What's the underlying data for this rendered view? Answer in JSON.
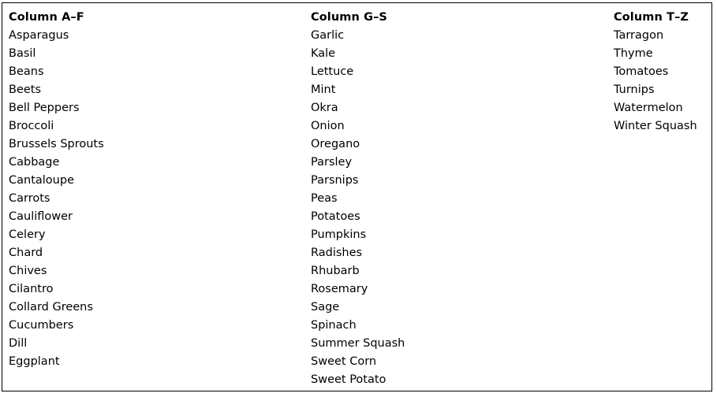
{
  "document": {
    "type": "three-column-list",
    "border_color": "#000000",
    "background_color": "#ffffff",
    "text_color": "#000000"
  },
  "columns": [
    {
      "header": "Column A–F",
      "items": [
        "Asparagus",
        "Basil",
        "Beans",
        "Beets",
        "Bell Peppers",
        "Broccoli",
        "Brussels Sprouts",
        "Cabbage",
        "Cantaloupe",
        "Carrots",
        "Cauliflower",
        "Celery",
        "Chard",
        "Chives",
        "Cilantro",
        "Collard Greens",
        "Cucumbers",
        "Dill",
        "Eggplant"
      ]
    },
    {
      "header": "Column G–S",
      "items": [
        "Garlic",
        "Kale",
        "Lettuce",
        "Mint",
        "Okra",
        "Onion",
        "Oregano",
        "Parsley",
        "Parsnips",
        "Peas",
        "Potatoes",
        "Pumpkins",
        "Radishes",
        "Rhubarb",
        "Rosemary",
        "Sage",
        "Spinach",
        "Summer Squash",
        "Sweet Corn",
        "Sweet Potato"
      ]
    },
    {
      "header": "Column T–Z",
      "items": [
        "Tarragon",
        "Thyme",
        "Tomatoes",
        "Turnips",
        "Watermelon",
        "Winter Squash"
      ]
    }
  ]
}
